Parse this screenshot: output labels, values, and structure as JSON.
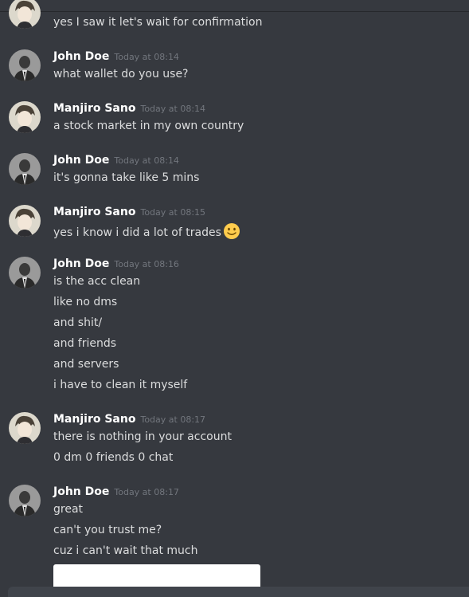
{
  "messages": [
    {
      "author": "",
      "time": "",
      "avatar": "anime-avatar",
      "lines": [
        "yes I saw it let's wait for confirmation"
      ]
    },
    {
      "author": "John Doe",
      "time": "Today at 08:14",
      "avatar": "suit-avatar",
      "lines": [
        "what wallet do you use?"
      ]
    },
    {
      "author": "Manjiro Sano",
      "time": "Today at 08:14",
      "avatar": "anime-avatar",
      "lines": [
        "a stock market in my own country"
      ]
    },
    {
      "author": "John Doe",
      "time": "Today at 08:14",
      "avatar": "suit-avatar",
      "lines": [
        "it's gonna take like 5 mins"
      ]
    },
    {
      "author": "Manjiro Sano",
      "time": "Today at 08:15",
      "avatar": "anime-avatar",
      "lines": [
        "yes i know i did a lot of trades"
      ]
    },
    {
      "author": "John Doe",
      "time": "Today at 08:16",
      "avatar": "suit-avatar",
      "lines": [
        "is the acc clean",
        "like no dms",
        "and shit/",
        "and friends",
        "and servers",
        "i have to clean it myself"
      ]
    },
    {
      "author": "Manjiro Sano",
      "time": "Today at 08:17",
      "avatar": "anime-avatar",
      "lines": [
        "there is nothing in your account",
        "0 dm 0 friends 0 chat"
      ]
    },
    {
      "author": "John Doe",
      "time": "Today at 08:17",
      "avatar": "suit-avatar",
      "lines": [
        "great",
        "can't you trust me?",
        "cuz i can't wait that much"
      ]
    }
  ],
  "emoji": "slightly-smiling-face-icon",
  "colors": {
    "background": "#36393f",
    "username": "#ffffff",
    "text": "#dcddde",
    "timestamp": "#72767d"
  }
}
